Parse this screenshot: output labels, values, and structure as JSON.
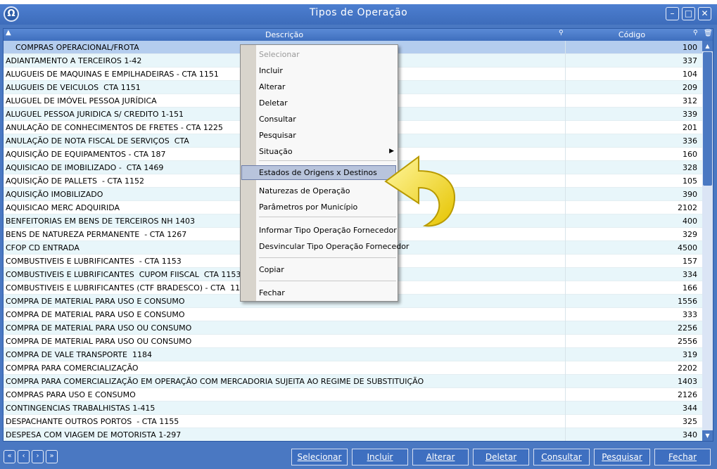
{
  "window": {
    "title": "Tipos de Operação",
    "logo_icon": "app-logo-icon"
  },
  "grid": {
    "headers": {
      "description": "Descrição",
      "code": "Código"
    },
    "rows": [
      {
        "description": "COMPRAS OPERACIONAL/FROTA",
        "code": "100"
      },
      {
        "description": "ADIANTAMENTO A TERCEIROS 1-42",
        "code": "337"
      },
      {
        "description": "ALUGUEIS DE MAQUINAS E EMPILHADEIRAS - CTA 1151",
        "code": "104"
      },
      {
        "description": "ALUGUEIS DE VEICULOS  CTA 1151",
        "code": "209"
      },
      {
        "description": "ALUGUEL DE IMÓVEL PESSOA JURÍDICA",
        "code": "312"
      },
      {
        "description": "ALUGUEL PESSOA JURIDICA S/ CREDITO 1-151",
        "code": "339"
      },
      {
        "description": "ANULAÇÃO DE CONHECIMENTOS DE FRETES - CTA 1225",
        "code": "201"
      },
      {
        "description": "ANULAÇÃO DE NOTA FISCAL DE SERVIÇOS  CTA",
        "code": "336"
      },
      {
        "description": "AQUISIÇÃO DE EQUIPAMENTOS - CTA 187",
        "code": "160"
      },
      {
        "description": "AQUISICAO DE IMOBILIZADO -  CTA 1469",
        "code": "328"
      },
      {
        "description": "AQUISIÇÃO DE PALLETS  - CTA 1152",
        "code": "105"
      },
      {
        "description": "AQUISIÇÃO IMOBILIZADO",
        "code": "390"
      },
      {
        "description": "AQUISICAO MERC ADQUIRIDA",
        "code": "2102"
      },
      {
        "description": "BENFEITORIAS EM BENS DE TERCEIROS NH 1403",
        "code": "400"
      },
      {
        "description": "BENS DE NATUREZA PERMANENTE  - CTA 1267",
        "code": "329"
      },
      {
        "description": "CFOP CD ENTRADA",
        "code": "4500"
      },
      {
        "description": "COMBUSTIVEIS E LUBRIFICANTES  - CTA 1153",
        "code": "157"
      },
      {
        "description": "COMBUSTIVEIS E LUBRIFICANTES  CUPOM FIISCAL  CTA 1153",
        "code": "334"
      },
      {
        "description": "COMBUSTIVEIS E LUBRIFICANTES (CTF BRADESCO) - CTA  1153",
        "code": "166"
      },
      {
        "description": "COMPRA DE MATERIAL PARA USO E CONSUMO",
        "code": "1556"
      },
      {
        "description": "COMPRA DE MATERIAL PARA USO E CONSUMO",
        "code": "333"
      },
      {
        "description": "COMPRA DE MATERIAL PARA USO OU CONSUMO",
        "code": "2256"
      },
      {
        "description": "COMPRA DE MATERIAL PARA USO OU CONSUMO",
        "code": "2556"
      },
      {
        "description": "COMPRA DE VALE TRANSPORTE  1184",
        "code": "319"
      },
      {
        "description": "COMPRA PARA COMERCIALIZAÇÃO",
        "code": "2202"
      },
      {
        "description": "COMPRA PARA COMERCIALIZAÇÃO EM OPERAÇÃO COM MERCADORIA SUJEITA AO REGIME DE SUBSTITUIÇÃO",
        "code": "1403"
      },
      {
        "description": "COMPRAS PARA USO E CONSUMO",
        "code": "2126"
      },
      {
        "description": "CONTINGENCIAS TRABALHISTAS 1-415",
        "code": "344"
      },
      {
        "description": "DESPACHANTE OUTROS PORTOS  - CTA 1155",
        "code": "325"
      },
      {
        "description": "DESPESA COM VIAGEM DE MOTORISTA 1-297",
        "code": "340"
      }
    ]
  },
  "context_menu": {
    "items": [
      {
        "label": "Selecionar",
        "enabled": false
      },
      {
        "label": "Incluir"
      },
      {
        "label": "Alterar"
      },
      {
        "label": "Deletar"
      },
      {
        "label": "Consultar"
      },
      {
        "label": "Pesquisar"
      },
      {
        "label": "Situação",
        "submenu": true
      },
      {
        "label": "Estados de Origens x Destinos",
        "highlighted": true
      },
      {
        "label": "Naturezas de Operação"
      },
      {
        "label": "Parâmetros por Município"
      },
      {
        "label": "Informar Tipo Operação Fornecedor"
      },
      {
        "label": "Desvincular Tipo Operação Fornecedor"
      },
      {
        "label": "Copiar"
      },
      {
        "label": "Fechar"
      }
    ]
  },
  "buttons": {
    "selecionar": "Selecionar",
    "incluir": "Incluir",
    "alterar": "Alterar",
    "deletar": "Deletar",
    "consultar": "Consultar",
    "pesquisar": "Pesquisar",
    "fechar": "Fechar"
  },
  "colors": {
    "accent": "#4a78c2",
    "row_alt": "#e8f6fa",
    "selected_row": "#b4cdee",
    "pointer_arrow": "#f2dd2a"
  }
}
